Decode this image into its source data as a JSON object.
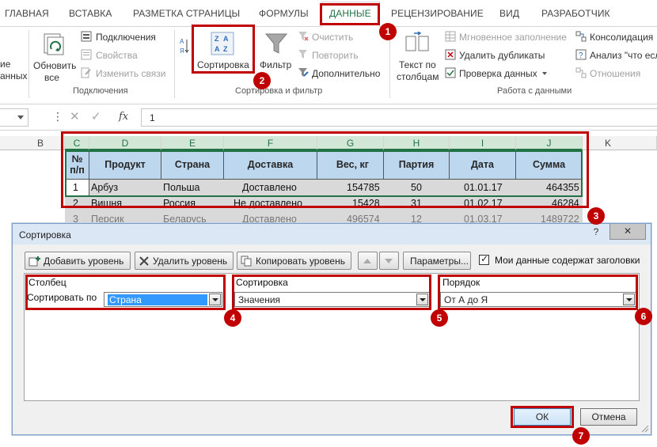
{
  "ribbon_tabs": [
    "ГЛАВНАЯ",
    "ВСТАВКА",
    "РАЗМЕТКА СТРАНИЦЫ",
    "ФОРМУЛЫ",
    "ДАННЫЕ",
    "РЕЦЕНЗИРОВАНИЕ",
    "ВИД",
    "РАЗРАБОТЧИК"
  ],
  "ribbon": {
    "partial_left_1": "ие",
    "partial_left_2": "анных",
    "refresh_all_1": "Обновить",
    "refresh_all_2": "все",
    "connections": "Подключения",
    "properties": "Свойства",
    "edit_links": "Изменить связи",
    "group_connections": "Подключения",
    "sort": "Сортировка",
    "filter": "Фильтр",
    "clear": "Очистить",
    "reapply": "Повторить",
    "advanced": "Дополнительно",
    "group_sort_filter": "Сортировка и фильтр",
    "text_to_columns_1": "Текст по",
    "text_to_columns_2": "столбцам",
    "flash_fill": "Мгновенное заполнение",
    "remove_duplicates": "Удалить дубликаты",
    "data_validation": "Проверка данных",
    "consolidate": "Консолидация",
    "what_if": "Анализ \"что есл",
    "relationships": "Отношения",
    "group_data_tools": "Работа с данными"
  },
  "formula_bar": {
    "value": "1",
    "fx": "fx"
  },
  "sheet": {
    "columns": [
      "B",
      "C",
      "D",
      "E",
      "F",
      "G",
      "H",
      "I",
      "J",
      "K"
    ],
    "headers": [
      "№ п/п",
      "Продукт",
      "Страна",
      "Доставка",
      "Вес, кг",
      "Партия",
      "Дата",
      "Сумма"
    ],
    "rows": [
      [
        "1",
        "Арбуз",
        "Польша",
        "Доставлено",
        "154785",
        "50",
        "01.01.17",
        "464355"
      ],
      [
        "2",
        "Вишня",
        "Россия",
        "Не доставлено",
        "15428",
        "31",
        "01.02.17",
        "46284"
      ],
      [
        "3",
        "Персик",
        "Беларусь",
        "Доставлено",
        "496574",
        "12",
        "01.03.17",
        "1489722"
      ]
    ]
  },
  "dialog": {
    "title": "Сортировка",
    "help": "?",
    "close": "✕",
    "add_level": "Добавить уровень",
    "delete_level": "Удалить уровень",
    "copy_level": "Копировать уровень",
    "options": "Параметры...",
    "has_headers": "Мои данные содержат заголовки",
    "col_header": "Столбец",
    "sort_header": "Сортировка",
    "order_header": "Порядок",
    "sort_by": "Сортировать по",
    "column_value": "Страна",
    "sort_on_value": "Значения",
    "order_value": "От А до Я",
    "ok": "ОК",
    "cancel": "Отмена"
  },
  "badges": [
    "1",
    "2",
    "3",
    "4",
    "5",
    "6",
    "7"
  ],
  "colors": {
    "accent": "#217346",
    "annotation": "#c00000",
    "header_fill": "#bdd7ee"
  }
}
